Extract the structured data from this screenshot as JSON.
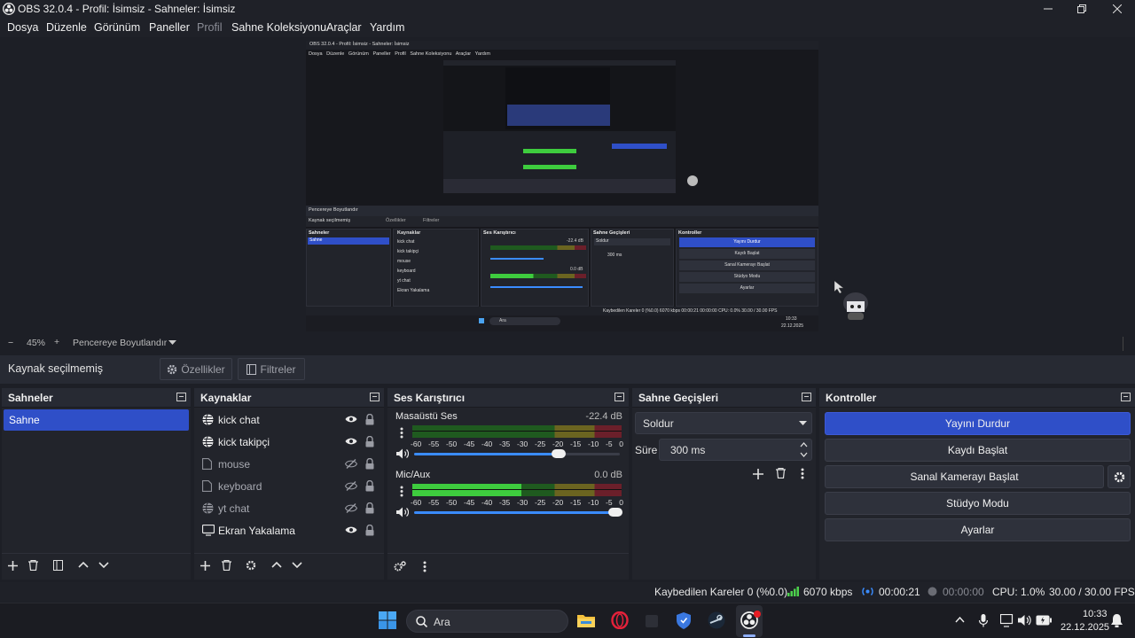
{
  "window": {
    "title": "OBS 32.0.4 - Profil: İsimsiz - Sahneler: İsimsiz"
  },
  "menu": [
    "Dosya",
    "Düzenle",
    "Görünüm",
    "Paneller",
    "Profil",
    "Sahne Koleksiyonu",
    "Araçlar",
    "Yardım"
  ],
  "zoom": {
    "minus": "−",
    "value": "45%",
    "plus": "+",
    "fit_label": "Pencereye Boyutlandır"
  },
  "context": {
    "no_source": "Kaynak seçilmemiş",
    "properties": "Özellikler",
    "filters": "Filtreler"
  },
  "scenes": {
    "title": "Sahneler",
    "items": [
      "Sahne"
    ]
  },
  "sources": {
    "title": "Kaynaklar",
    "items": [
      {
        "name": "kick chat",
        "icon": "browser-icon",
        "visible": true
      },
      {
        "name": "kick takipçi",
        "icon": "browser-icon",
        "visible": true
      },
      {
        "name": "mouse",
        "icon": "file-icon",
        "visible": false
      },
      {
        "name": "keyboard",
        "icon": "file-icon",
        "visible": false
      },
      {
        "name": "yt chat",
        "icon": "browser-icon",
        "visible": false
      },
      {
        "name": "Ekran Yakalama",
        "icon": "monitor-icon",
        "visible": true
      }
    ]
  },
  "mixer": {
    "title": "Ses Karıştırıcı",
    "channels": [
      {
        "name": "Masaüstü Ses",
        "db": "-22.4 dB",
        "level": 0.0,
        "volume": 0.72
      },
      {
        "name": "Mic/Aux",
        "db": "0.0 dB",
        "level": 0.52,
        "volume": 1.0
      }
    ],
    "ticks": [
      "-60",
      "-55",
      "-50",
      "-45",
      "-40",
      "-35",
      "-30",
      "-25",
      "-20",
      "-15",
      "-10",
      "-5",
      "0"
    ]
  },
  "transitions": {
    "title": "Sahne Geçişleri",
    "selected": "Soldur",
    "duration_label": "Süre",
    "duration_value": "300 ms"
  },
  "controls": {
    "title": "Kontroller",
    "stop_stream": "Yayını Durdur",
    "start_record": "Kaydı Başlat",
    "start_vcam": "Sanal Kamerayı Başlat",
    "studio_mode": "Stüdyo Modu",
    "settings": "Ayarlar",
    "accent": "#2f4fc8"
  },
  "status": {
    "dropped": "Kaybedilen Kareler 0 (%0.0)",
    "bitrate": "6070 kbps",
    "stream_time": "00:00:21",
    "record_time": "00:00:00",
    "cpu": "CPU: 1.0%",
    "fps": "30.00 / 30.00 FPS"
  },
  "taskbar": {
    "search_placeholder": "Ara",
    "time": "10:33",
    "date": "22.12.2025"
  },
  "preview_mini": {
    "title": "OBS 32.0.4 - Profil: İsimsiz - Sahneler: İsimsiz",
    "no_source": "Kaynak seçilmemiş",
    "properties": "Özellikler",
    "filters": "Filtreler",
    "fit": "Pencereye Boyutlandır",
    "desktop_db": "-22.4 dB",
    "mic_db": "0.0 dB",
    "duration": "300 ms",
    "status": "Kaybedilen Kareler 0 (%0.0)   6070 kbps   00:00:21   00:00:00   CPU: 0.0%   30.00 / 30.00 FPS",
    "search": "Ara",
    "time": "10:33",
    "date": "22.12.2025"
  }
}
